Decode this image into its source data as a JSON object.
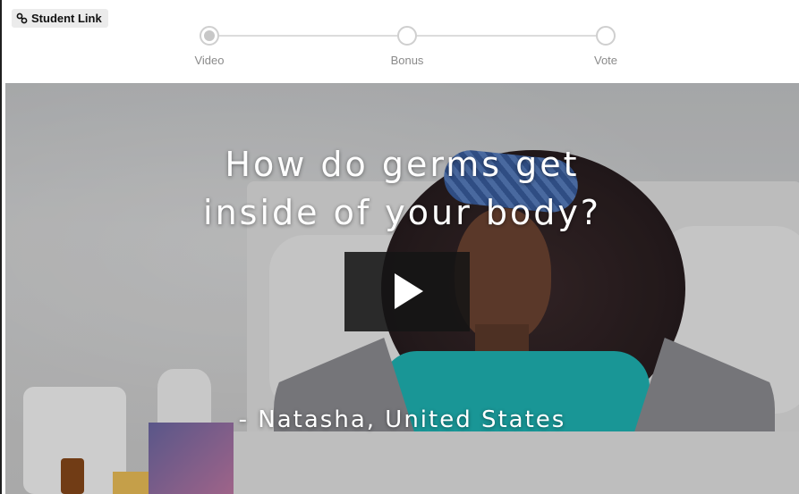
{
  "header": {
    "student_link": {
      "label": "Student Link",
      "icon": "link-icon"
    },
    "steps": [
      {
        "label": "Video",
        "active": true
      },
      {
        "label": "Bonus",
        "active": false
      },
      {
        "label": "Vote",
        "active": false
      }
    ]
  },
  "video": {
    "title": "How do germs get\ninside of your body?",
    "attribution": "- Natasha, United States",
    "play_icon": "play-icon",
    "colors": {
      "overlay_button": "#141414",
      "shirt": "#1fb7b8",
      "ice_pack": "#3a5fa0"
    }
  }
}
